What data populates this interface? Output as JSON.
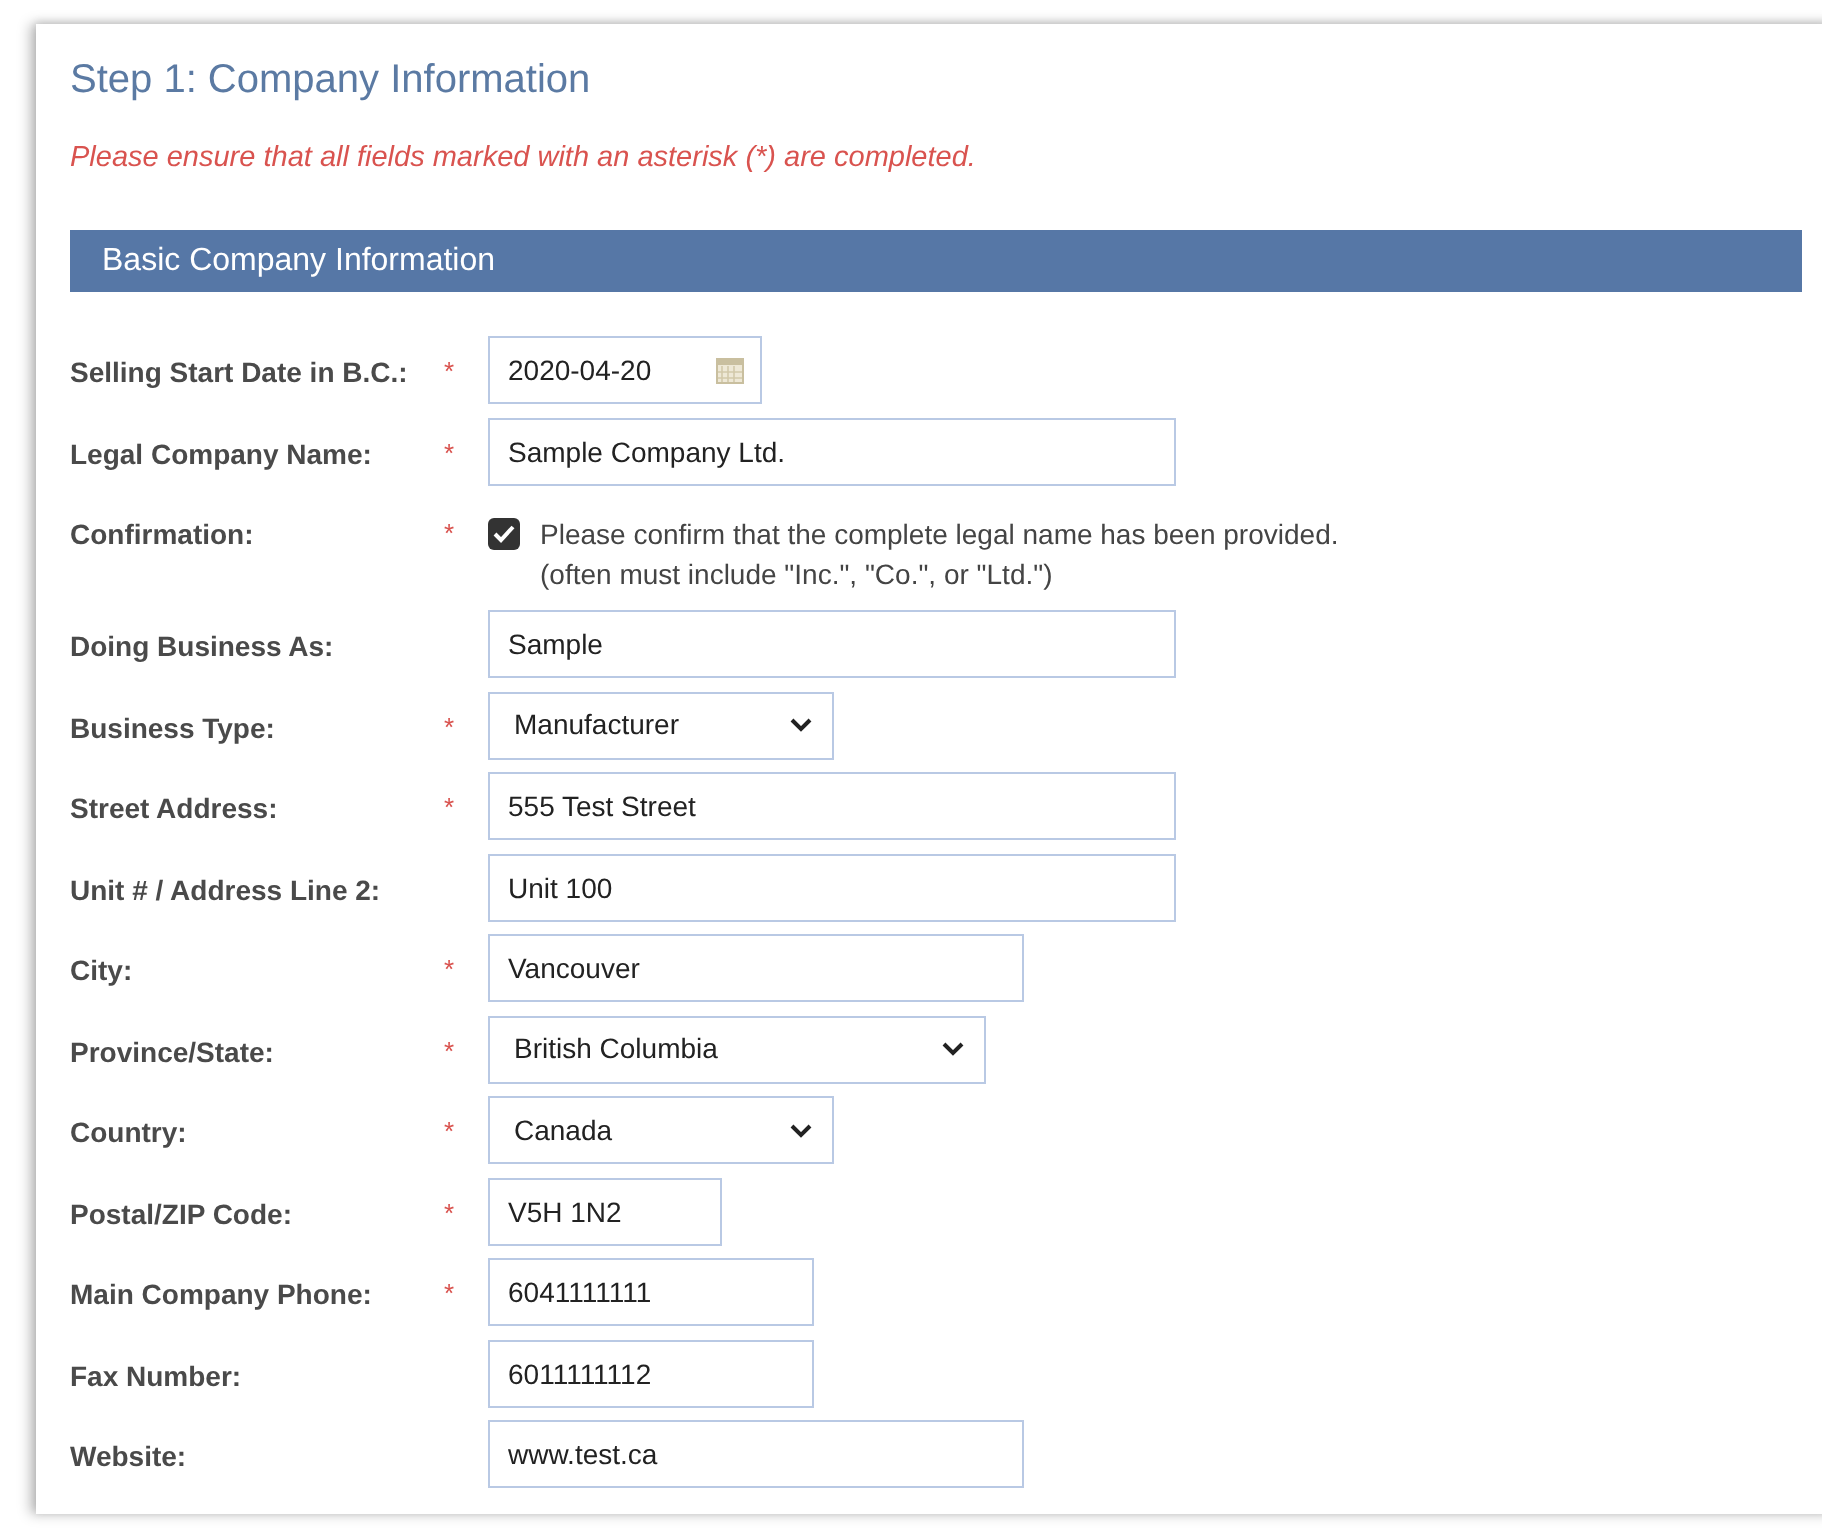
{
  "title": "Step 1: Company Information",
  "notice": "Please ensure that all fields marked with an asterisk (*) are completed.",
  "section": {
    "title": "Basic Company Information"
  },
  "fields": [
    {
      "label": "Selling Start Date in B.C.:",
      "required_mark": "*",
      "kind": "date",
      "value": "2020-04-20"
    },
    {
      "label": "Legal Company Name:",
      "required_mark": "*",
      "kind": "text",
      "value": "Sample Company Ltd."
    },
    {
      "label": "Confirmation:",
      "required_mark": "*",
      "kind": "checkbox",
      "checked": true,
      "text": "Please confirm that the complete legal name has been provided.",
      "note": "(often must include \"Inc.\", \"Co.\", or \"Ltd.\")"
    },
    {
      "label": "Doing Business As:",
      "kind": "text",
      "value": "Sample"
    },
    {
      "label": "Business Type:",
      "required_mark": "*",
      "kind": "select",
      "value": "Manufacturer"
    },
    {
      "label": "Street Address:",
      "required_mark": "*",
      "kind": "text",
      "value": "555 Test Street"
    },
    {
      "label": "Unit # / Address Line 2:",
      "kind": "text",
      "value": "Unit 100"
    },
    {
      "label": "City:",
      "required_mark": "*",
      "kind": "text",
      "value": "Vancouver"
    },
    {
      "label": "Province/State:",
      "required_mark": "*",
      "kind": "select",
      "value": "British Columbia"
    },
    {
      "label": "Country:",
      "required_mark": "*",
      "kind": "select",
      "value": "Canada"
    },
    {
      "label": "Postal/ZIP Code:",
      "required_mark": "*",
      "kind": "text",
      "value": "V5H 1N2"
    },
    {
      "label": "Main Company Phone:",
      "required_mark": "*",
      "kind": "text",
      "value": "6041111111"
    },
    {
      "label": "Fax Number:",
      "kind": "text",
      "value": "6011111112"
    },
    {
      "label": "Website:",
      "kind": "text",
      "value": "www.test.ca"
    }
  ]
}
